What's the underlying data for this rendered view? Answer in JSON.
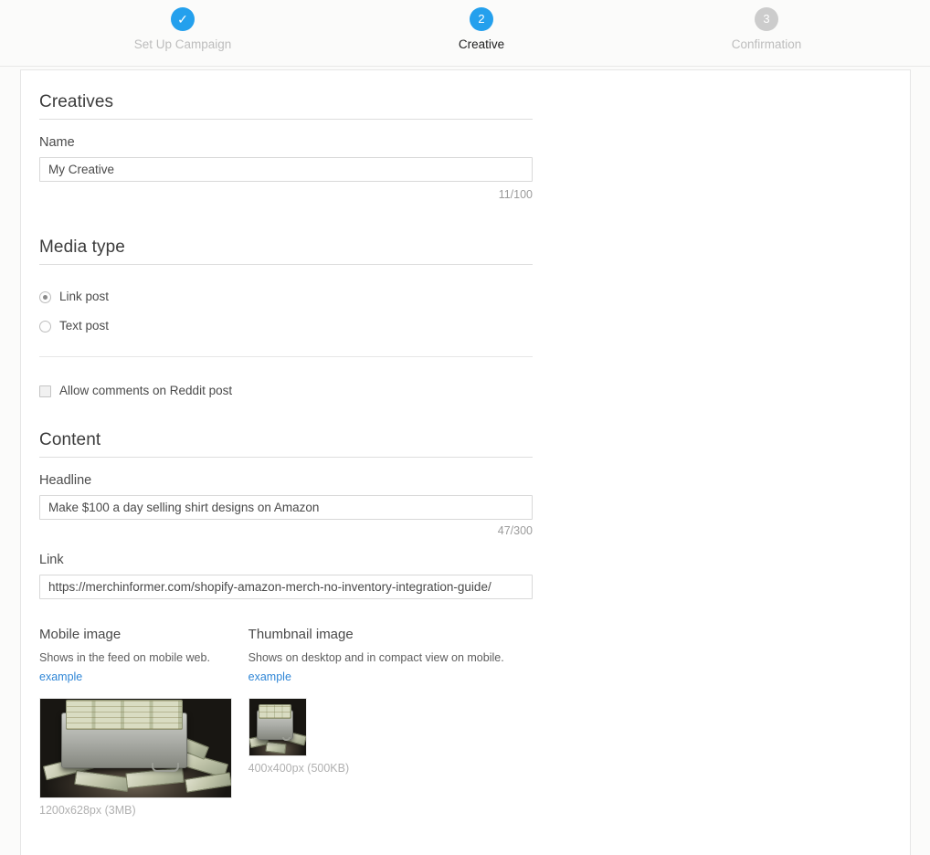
{
  "stepper": {
    "steps": [
      {
        "marker": "✓",
        "label": "Set Up Campaign",
        "state": "done"
      },
      {
        "marker": "2",
        "label": "Creative",
        "state": "active"
      },
      {
        "marker": "3",
        "label": "Confirmation",
        "state": "todo"
      }
    ]
  },
  "creatives": {
    "section_title": "Creatives",
    "name_label": "Name",
    "name_value": "My Creative",
    "name_placeholder": "",
    "name_counter": "11/100"
  },
  "media_type": {
    "section_title": "Media type",
    "options": [
      {
        "label": "Link post",
        "selected": true
      },
      {
        "label": "Text post",
        "selected": false
      }
    ],
    "allow_comments_label": "Allow comments on Reddit post",
    "allow_comments_checked": false
  },
  "content": {
    "section_title": "Content",
    "headline_label": "Headline",
    "headline_value": "Make $100 a day selling shirt designs on Amazon",
    "headline_counter": "47/300",
    "link_label": "Link",
    "link_value": "https://merchinformer.com/shopify-amazon-merch-no-inventory-integration-guide/"
  },
  "images": {
    "mobile": {
      "title": "Mobile image",
      "description": "Shows in the feed on mobile web.",
      "example_link": "example",
      "caption": "1200x628px (3MB)"
    },
    "thumbnail": {
      "title": "Thumbnail image",
      "description": "Shows on desktop and in compact view on mobile.",
      "example_link": "example",
      "caption": "400x400px (500KB)"
    }
  },
  "colors": {
    "accent": "#24a0ed",
    "link": "#2f86d6",
    "inactive": "#cccccc",
    "page_bg": "#fbfbfa"
  }
}
